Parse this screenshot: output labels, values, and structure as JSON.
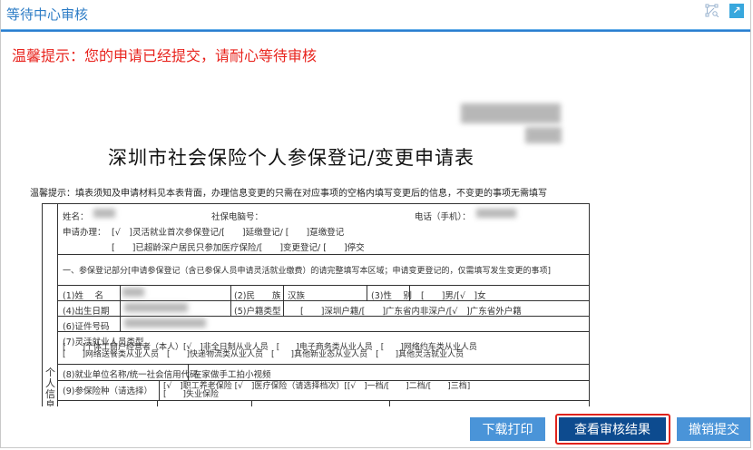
{
  "window": {
    "title": "等待中心审核",
    "icons": [
      "workflow-search-icon",
      "external-link-icon"
    ]
  },
  "notice": "温馨提示：您的申请已经提交，请耐心等待审核",
  "document": {
    "title": "深圳市社会保险个人参保登记/变更申请表",
    "hint": "温馨提示：填表须知及申请材料见本表背面，办理信息变更的只需在对应事项的空格内填写变更后的信息，不变更的事项无需填写",
    "name_label": "姓名：",
    "ss_label": "社保电脑号：",
    "phone_label": "电话（手机）：",
    "apply_label": "申请办理：",
    "apply_line1": "[√　]灵活就业首次参保登记/[　　]延缴登记/ [　　]趸缴登记",
    "apply_line2": "[　　]已超龄深户居民只参加医疗保险/[　　]变更登记/ [　　]停交",
    "section1": "一、参保登记部分[申请参保登记（含已参保人员申请灵活就业缴费）的请完整填写本区域；申请变更登记的，仅需填写发生变更的事项]",
    "side_label": "个人信息及",
    "rows": {
      "r1": [
        "(1)姓　 名",
        "(2)民　　族",
        "汉族",
        "(3)性　 别",
        "[　　]男/[√　]女"
      ],
      "r2": [
        "(4)出生日期",
        "(5)户籍类型",
        "[　　]深圳户籍/[　　]广东省内非深户/[√　]广东省外户籍"
      ],
      "r3": [
        "(6)证件号码"
      ],
      "r4": {
        "label": "(7)灵活就业人员类型",
        "l1": "[　　]个体工商户经营者（本人）[√　]非全日制从业人员　[　　]电子商务类从业人员　[　　]网络约车类从业人员",
        "l2": "[　　]网络送餐类从业人员　[　　]快递物流类从业人员　[　　]其他新业态从业人员　[　　]其他灵活就业人员"
      },
      "r5": [
        "(8)就业单位名称/统一社会信用代码",
        "在家做手工拍小视频"
      ],
      "r6": {
        "label": "(9)参保险种（请选择）",
        "l1": "[√　]职工养老保险 [√　]医疗保险（请选择档次）[[√　]一档/[　　]二档/[　　]三档]",
        "l2": "[　　]失业保险"
      }
    }
  },
  "buttons": {
    "download": "下载打印",
    "view_result": "查看审核结果",
    "revoke": "撤销提交"
  },
  "colors": {
    "accent": "#2a7fd0",
    "notice": "#e8231d",
    "primary_button": "#0d4b8f",
    "button": "#4a94d8",
    "highlight": "#e0231c"
  }
}
